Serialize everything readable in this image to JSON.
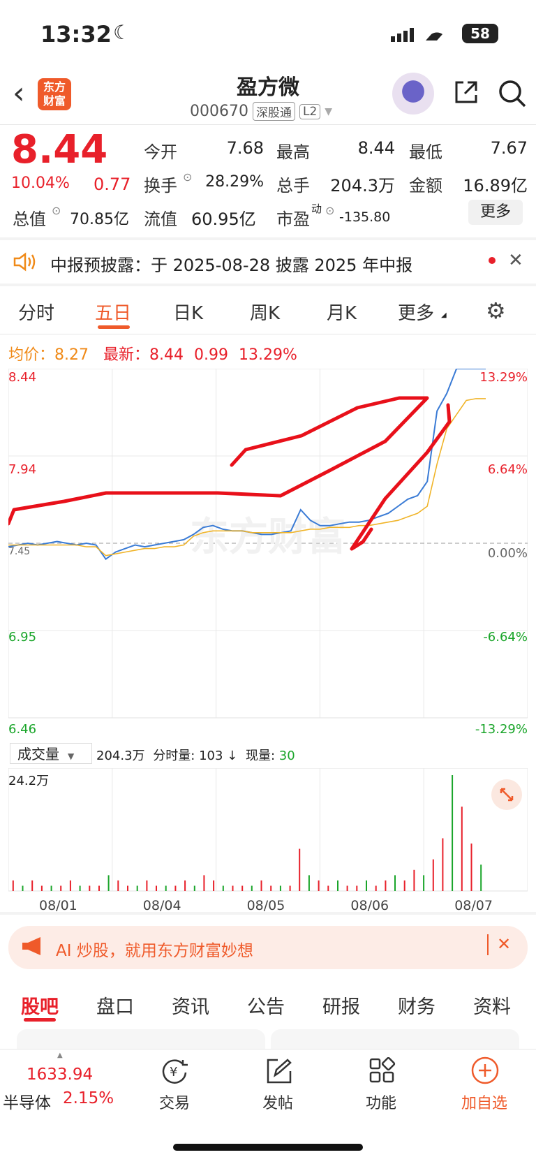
{
  "status": {
    "time": "13:32",
    "battery": "58"
  },
  "header": {
    "logo_line1": "东方",
    "logo_line2": "财富",
    "stock_name": "盈方微",
    "stock_code": "000670",
    "tag_market": "深股通",
    "tag_level": "L2"
  },
  "quote": {
    "price": "8.44",
    "change_pct": "10.04%",
    "change": "0.77",
    "open_label": "今开",
    "open": "7.68",
    "high_label": "最高",
    "high": "8.44",
    "low_label": "最低",
    "low": "7.67",
    "turnover_label": "换手",
    "turnover": "28.29%",
    "volume_label": "总手",
    "volume": "204.3万",
    "amount_label": "金额",
    "amount": "16.89亿",
    "mcap_label": "总值",
    "mcap": "70.85亿",
    "float_label": "流值",
    "float": "60.95亿",
    "pe_label": "市盈",
    "pe_sup": "动",
    "pe": "-135.80",
    "more": "更多"
  },
  "notice": {
    "text": "中报预披露：于 2025-08-28 披露 2025 年中报"
  },
  "chart_tabs": [
    "分时",
    "五日",
    "日K",
    "周K",
    "月K",
    "更多"
  ],
  "chart_tabs_active": 1,
  "chart_header": {
    "avg_label": "均价：",
    "avg": "8.27",
    "latest_label": "最新：",
    "latest": "8.44",
    "latest_chg": "0.99",
    "latest_pct": "13.29%"
  },
  "chart_data": {
    "type": "line",
    "x": [
      "08/01",
      "08/04",
      "08/05",
      "08/06",
      "08/07"
    ],
    "price_ticks_left": [
      "8.44",
      "7.94",
      "7.45",
      "6.95",
      "6.46"
    ],
    "pct_ticks_right": [
      "13.29%",
      "6.64%",
      "0.00%",
      "-6.64%",
      "-13.29%"
    ],
    "ylim": [
      6.46,
      8.44
    ],
    "prev_close": 7.45,
    "series": [
      {
        "values": [
          7.43,
          7.44,
          7.45,
          7.44,
          7.45,
          7.46,
          7.45,
          7.44,
          7.45,
          7.44,
          7.36,
          7.4,
          7.42,
          7.44,
          7.43,
          7.44,
          7.45,
          7.46,
          7.47,
          7.5,
          7.54,
          7.55,
          7.53,
          7.52,
          7.52,
          7.51,
          7.5,
          7.5,
          7.51,
          7.52,
          7.64,
          7.58,
          7.55,
          7.55,
          7.56,
          7.57,
          7.57,
          7.58,
          7.6,
          7.62,
          7.66,
          7.7,
          7.72,
          7.8,
          8.2,
          8.3,
          8.44,
          8.44,
          8.44,
          8.44
        ]
      },
      {
        "values": [
          7.44,
          7.44,
          7.44,
          7.44,
          7.44,
          7.44,
          7.44,
          7.44,
          7.43,
          7.43,
          7.38,
          7.39,
          7.4,
          7.41,
          7.42,
          7.42,
          7.43,
          7.43,
          7.44,
          7.49,
          7.51,
          7.52,
          7.52,
          7.52,
          7.52,
          7.51,
          7.51,
          7.51,
          7.51,
          7.51,
          7.52,
          7.53,
          7.53,
          7.54,
          7.54,
          7.54,
          7.55,
          7.55,
          7.56,
          7.57,
          7.58,
          7.6,
          7.62,
          7.66,
          7.9,
          8.1,
          8.18,
          8.26,
          8.27,
          8.27
        ]
      }
    ],
    "volume_max_label": "24.2万",
    "volume": [
      2,
      1,
      2,
      1,
      1,
      1,
      2,
      1,
      1,
      1,
      3,
      2,
      1,
      1,
      2,
      1,
      1,
      1,
      2,
      1,
      3,
      2,
      1,
      1,
      1,
      1,
      2,
      1,
      1,
      1,
      8,
      3,
      2,
      1,
      2,
      1,
      1,
      2,
      1,
      2,
      3,
      2,
      4,
      3,
      6,
      10,
      22,
      16,
      9,
      5
    ]
  },
  "volume_header": {
    "select": "成交量",
    "total": "204.3万",
    "fenshi_label": "分时量:",
    "fenshi": "103 ↓",
    "current_label": "现量:",
    "current": "30"
  },
  "ad": {
    "text": "AI 炒股，就用东方财富妙想"
  },
  "bottom_tabs": [
    "股吧",
    "盘口",
    "资讯",
    "公告",
    "研报",
    "财务",
    "资料"
  ],
  "toolbar": {
    "index_value": "1633.94",
    "index_name": "半导体",
    "index_pct": "2.15%",
    "trade": "交易",
    "post": "发帖",
    "function": "功能",
    "add_watch": "加自选"
  },
  "colors": {
    "up": "#e8202a",
    "down": "#1aa52a",
    "accent": "#ef5a2a",
    "price_line": "#3a7bd5",
    "avg_line": "#f0b429"
  }
}
